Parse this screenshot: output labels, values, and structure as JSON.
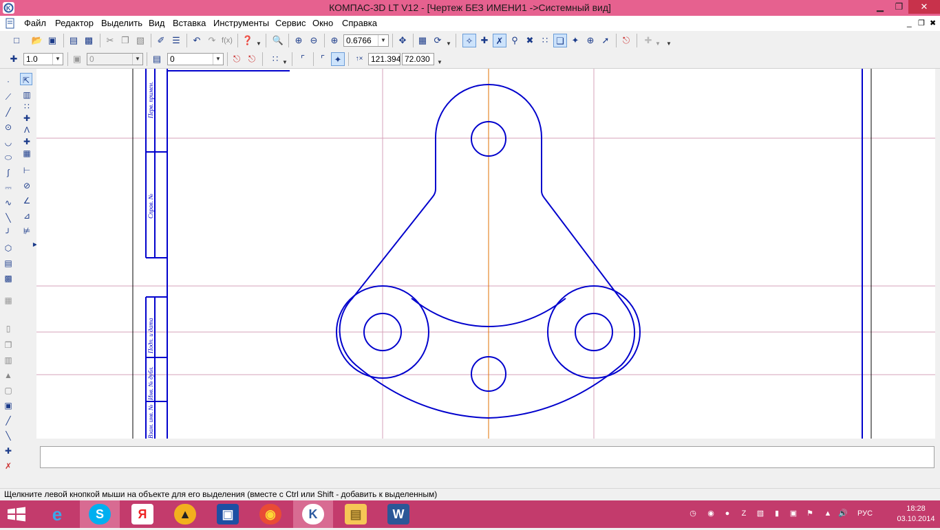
{
  "window": {
    "title": "КОМПАС-3D LT V12 - [Чертеж БЕЗ ИМЕНИ1 ->Системный вид]",
    "minimize": "▁",
    "restore": "❐",
    "close": "✕"
  },
  "doc_controls": {
    "minimize": "_",
    "restore": "❐",
    "close": "✖"
  },
  "menu": [
    {
      "label": "Файл"
    },
    {
      "label": "Редактор"
    },
    {
      "label": "Выделить"
    },
    {
      "label": "Вид"
    },
    {
      "label": "Вставка"
    },
    {
      "label": "Инструменты"
    },
    {
      "label": "Сервис"
    },
    {
      "label": "Окно"
    },
    {
      "label": "Справка"
    }
  ],
  "toolbar": {
    "zoom_value": "0.6766",
    "fx_label": "f(x)",
    "line_width": "1.0",
    "layer_value": "0",
    "style_value": "0",
    "coord_x": "121.394",
    "coord_y": "72.030"
  },
  "drawing": {
    "stamp_texts": [
      "Перв. примен.",
      "Справ. №",
      "Подп. и дата",
      "Инв. № дубл.",
      "Взам. инв. №"
    ],
    "line_color": "#0000cc",
    "axis_color": "#e07000",
    "grid_color": "#c0386e"
  },
  "status": {
    "message": "Щелкните левой кнопкой мыши на объекте для его выделения (вместе с Ctrl или Shift - добавить к выделенным)"
  },
  "taskbar": {
    "apps": [
      {
        "name": "windows-start",
        "glyph": "⊞"
      },
      {
        "name": "internet-explorer",
        "glyph": "e"
      },
      {
        "name": "skype",
        "glyph": "S"
      },
      {
        "name": "yandex-browser",
        "glyph": "Я"
      },
      {
        "name": "archicad",
        "glyph": "▲"
      },
      {
        "name": "save-disk",
        "glyph": "▣"
      },
      {
        "name": "chrome",
        "glyph": "◉"
      },
      {
        "name": "kompas",
        "glyph": "K"
      },
      {
        "name": "file-explorer",
        "glyph": "▤"
      },
      {
        "name": "word",
        "glyph": "W"
      }
    ],
    "language": "РУС",
    "time": "18:28",
    "date": "03.10.2014"
  }
}
